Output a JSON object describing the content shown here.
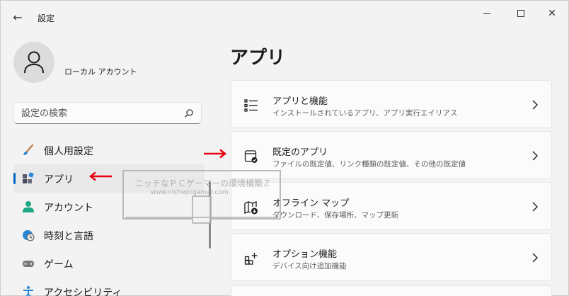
{
  "window": {
    "title": "設定",
    "back_glyph": "←",
    "close_glyph": "✕"
  },
  "user": {
    "name": "ローカル アカウント"
  },
  "search": {
    "placeholder": "設定の検索"
  },
  "sidebar": {
    "items": [
      {
        "label": "個人用設定",
        "icon": "brush-icon",
        "active": false
      },
      {
        "label": "アプリ",
        "icon": "apps-icon",
        "active": true
      },
      {
        "label": "アカウント",
        "icon": "account-icon",
        "active": false
      },
      {
        "label": "時刻と言語",
        "icon": "clock-globe-icon",
        "active": false
      },
      {
        "label": "ゲーム",
        "icon": "gamepad-icon",
        "active": false
      },
      {
        "label": "アクセシビリティ",
        "icon": "accessibility-icon",
        "active": false
      }
    ]
  },
  "main": {
    "title": "アプリ",
    "cards": [
      {
        "title": "アプリと機能",
        "desc": "インストールされているアプリ、アプリ実行エイリアス",
        "icon": "apps-list-icon"
      },
      {
        "title": "既定のアプリ",
        "desc": "ファイルの既定値、リンク種類の既定値、その他の既定値",
        "icon": "default-apps-icon"
      },
      {
        "title": "オフライン マップ",
        "desc": "ダウンロード、保存場所、マップ更新",
        "icon": "offline-map-icon"
      },
      {
        "title": "オプション機能",
        "desc": "デバイス向け追加機能",
        "icon": "optional-features-icon"
      }
    ]
  },
  "watermark": {
    "line1": "ニッチなＰＣゲーマーの環境構築Ｚ",
    "line2": "www.nichepcgamer.com"
  },
  "colors": {
    "accent": "#0067c0",
    "annotation_red": "#e60012",
    "background": "#f3f3f3",
    "card": "#fbfbfb"
  }
}
